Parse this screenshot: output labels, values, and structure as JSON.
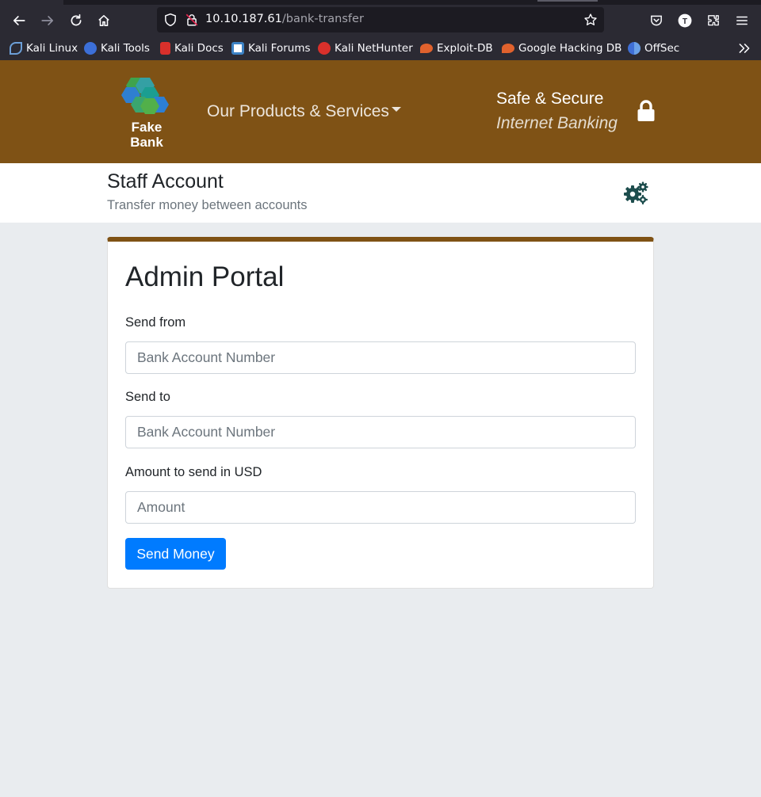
{
  "browser": {
    "url_host": "10.10.187.61",
    "url_path": "/bank-transfer",
    "profile_initial": "T",
    "bookmarks": [
      {
        "label": "Kali Linux",
        "color": "#3c82c4"
      },
      {
        "label": "Kali Tools",
        "color": "#3c6fd8"
      },
      {
        "label": "Kali Docs",
        "color": "#d9302b"
      },
      {
        "label": "Kali Forums",
        "color": "#3c82c4"
      },
      {
        "label": "Kali NetHunter",
        "color": "#d9302b"
      },
      {
        "label": "Exploit-DB",
        "color": "#e0622d"
      },
      {
        "label": "Google Hacking DB",
        "color": "#e0622d"
      },
      {
        "label": "OffSec",
        "color": "#3f6fd6"
      }
    ]
  },
  "header": {
    "logo_line1": "Fake",
    "logo_line2": "Bank",
    "nav_products": "Our Products & Services",
    "secure_line1": "Safe & Secure",
    "secure_line2": "Internet Banking",
    "brand_color": "#7f5215"
  },
  "subheader": {
    "title": "Staff Account",
    "subtitle": "Transfer money between accounts"
  },
  "form": {
    "title": "Admin Portal",
    "from_label": "Send from",
    "from_placeholder": "Bank Account Number",
    "to_label": "Send to",
    "to_placeholder": "Bank Account Number",
    "amount_label": "Amount to send in USD",
    "amount_placeholder": "Amount",
    "submit_label": "Send Money",
    "accent_color": "#007bff"
  }
}
